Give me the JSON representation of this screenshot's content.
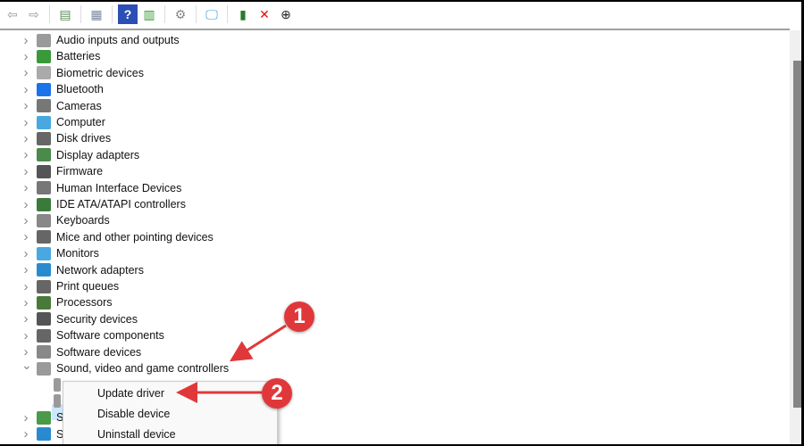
{
  "toolbar": {
    "buttons": [
      {
        "name": "back-arrow-icon",
        "glyph": "⇦",
        "color": "#999"
      },
      {
        "name": "forward-arrow-icon",
        "glyph": "⇨",
        "color": "#999"
      },
      {
        "sep": true
      },
      {
        "name": "show-hide-console-tree-icon",
        "glyph": "▤",
        "color": "#5a8a5a"
      },
      {
        "sep": true
      },
      {
        "name": "properties-icon",
        "glyph": "▦",
        "color": "#7a8aa0"
      },
      {
        "sep": true
      },
      {
        "name": "help-icon",
        "glyph": "?",
        "color": "#fff",
        "bg": "#2b4fb5"
      },
      {
        "name": "action-pane-icon",
        "glyph": "▥",
        "color": "#3a9a3a"
      },
      {
        "sep": true
      },
      {
        "name": "update-driver-icon",
        "glyph": "⚙",
        "color": "#888"
      },
      {
        "sep": true
      },
      {
        "name": "scan-hardware-changes-icon",
        "glyph": "🖵",
        "color": "#2a9ad8"
      },
      {
        "sep": true
      },
      {
        "name": "enable-device-icon",
        "glyph": "▮",
        "color": "#2a7a2a"
      },
      {
        "name": "uninstall-device-icon",
        "glyph": "✕",
        "color": "#e01010"
      },
      {
        "name": "download-icon",
        "glyph": "⊕",
        "color": "#222"
      }
    ]
  },
  "tree": {
    "categories": [
      {
        "label": "Audio inputs and outputs",
        "icon": "speaker-icon",
        "color": "#9a9a9a",
        "expanded": false
      },
      {
        "label": "Batteries",
        "icon": "battery-icon",
        "color": "#3a9a3a",
        "expanded": false
      },
      {
        "label": "Biometric devices",
        "icon": "fingerprint-icon",
        "color": "#aaa",
        "expanded": false
      },
      {
        "label": "Bluetooth",
        "icon": "bluetooth-icon",
        "color": "#1a73e8",
        "expanded": false
      },
      {
        "label": "Cameras",
        "icon": "camera-icon",
        "color": "#777",
        "expanded": false
      },
      {
        "label": "Computer",
        "icon": "monitor-icon",
        "color": "#4aa8e0",
        "expanded": false
      },
      {
        "label": "Disk drives",
        "icon": "disk-drive-icon",
        "color": "#666",
        "expanded": false
      },
      {
        "label": "Display adapters",
        "icon": "display-adapter-icon",
        "color": "#4a8a4a",
        "expanded": false
      },
      {
        "label": "Firmware",
        "icon": "firmware-icon",
        "color": "#555",
        "expanded": false
      },
      {
        "label": "Human Interface Devices",
        "icon": "hid-icon",
        "color": "#777",
        "expanded": false
      },
      {
        "label": "IDE ATA/ATAPI controllers",
        "icon": "ide-controller-icon",
        "color": "#3a7a3a",
        "expanded": false
      },
      {
        "label": "Keyboards",
        "icon": "keyboard-icon",
        "color": "#888",
        "expanded": false
      },
      {
        "label": "Mice and other pointing devices",
        "icon": "mouse-icon",
        "color": "#666",
        "expanded": false
      },
      {
        "label": "Monitors",
        "icon": "monitor-icon",
        "color": "#4aa8e0",
        "expanded": false
      },
      {
        "label": "Network adapters",
        "icon": "network-adapter-icon",
        "color": "#2a8ad0",
        "expanded": false
      },
      {
        "label": "Print queues",
        "icon": "printer-icon",
        "color": "#666",
        "expanded": false
      },
      {
        "label": "Processors",
        "icon": "processor-icon",
        "color": "#4a7a3a",
        "expanded": false
      },
      {
        "label": "Security devices",
        "icon": "security-device-icon",
        "color": "#555",
        "expanded": false
      },
      {
        "label": "Software components",
        "icon": "software-component-icon",
        "color": "#666",
        "expanded": false
      },
      {
        "label": "Software devices",
        "icon": "software-device-icon",
        "color": "#888",
        "expanded": false
      },
      {
        "label": "Sound, video and game controllers",
        "icon": "speaker-icon",
        "color": "#9a9a9a",
        "expanded": true
      },
      {
        "label": "",
        "icon": "speaker-icon",
        "color": "#9a9a9a",
        "child": true,
        "selected": true
      },
      {
        "label": "",
        "icon": "speaker-icon",
        "color": "#9a9a9a",
        "child": true
      },
      {
        "label": "S",
        "icon": "storage-controller-icon",
        "color": "#4a9a4a",
        "expanded": false
      },
      {
        "label": "S",
        "icon": "system-devices-icon",
        "color": "#2a8ad0",
        "expanded": false
      }
    ]
  },
  "context_menu": {
    "items": [
      "Update driver",
      "Disable device",
      "Uninstall device"
    ]
  },
  "annotations": {
    "step1": "1",
    "step2": "2",
    "color": "#e0383a"
  }
}
